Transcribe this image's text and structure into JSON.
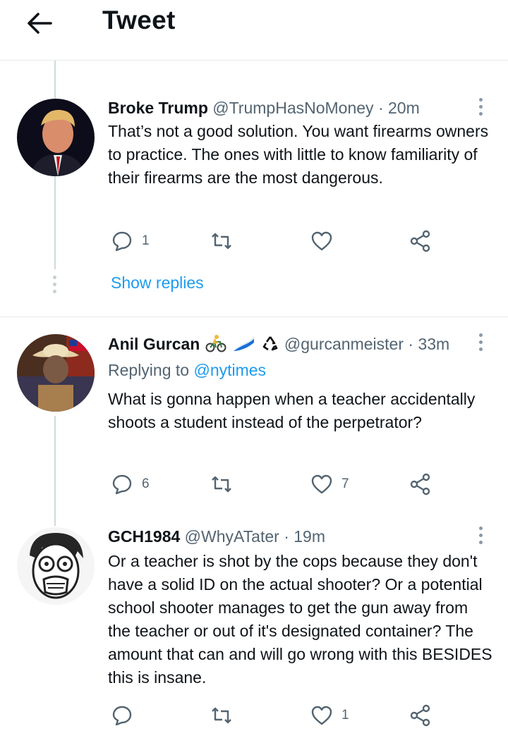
{
  "header": {
    "title": "Tweet",
    "back_icon": "arrow-left-icon"
  },
  "colors": {
    "link_blue": "#1d9bf0",
    "muted_gray": "#536471",
    "thread_line": "#cfd9de",
    "icon_gray": "#536471"
  },
  "tweets": [
    {
      "name": "Broke Trump",
      "handle": "@TrumpHasNoMoney",
      "time": "· 20m",
      "text": "That’s not a good solution. You want firearms owners to practice. The ones with little to know familiarity of their firearms are the most dangerous.",
      "replies": "1",
      "retweets": "",
      "likes": "",
      "show_replies": "Show replies"
    },
    {
      "name": "Anil Gurcan",
      "name_emojis": [
        "bicyclist-emoji",
        "wave-flag-emoji",
        "recycle-emoji"
      ],
      "handle": "@gurcanmeister",
      "time": "· 33m",
      "replying_prefix": "Replying to",
      "replying_to": "@nytimes",
      "text": "What is gonna happen when a teacher accidentally shoots a student instead of the perpetrator?",
      "replies": "6",
      "retweets": "",
      "likes": "7"
    },
    {
      "name": "GCH1984",
      "handle": "@WhyATater",
      "time": "· 19m",
      "text": "Or a teacher is shot by the cops because they don't have a solid ID on the actual shooter? Or a potential school shooter manages to get the gun away from the teacher or out of it's designated container? The amount that can and will go wrong with this BESIDES this is insane.",
      "replies": "",
      "retweets": "",
      "likes": "1"
    }
  ]
}
